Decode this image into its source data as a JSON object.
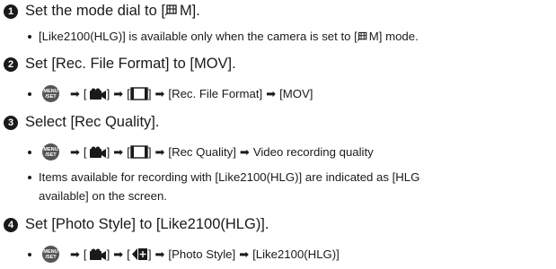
{
  "steps": [
    {
      "number": "1",
      "prefix": "Set the mode dial to [",
      "suffix": "M].",
      "notes": [
        {
          "prefix": "[Like2100(HLG)] is available only when the camera is set to [",
          "suffix": "M] mode."
        }
      ]
    },
    {
      "number": "2",
      "text": "Set [Rec. File Format] to [MOV].",
      "path": {
        "menu_icon": "menu-set-icon",
        "menu_label": [
          "MENU",
          "/SET"
        ],
        "items": [
          "[Rec. File Format]",
          "[MOV]"
        ]
      }
    },
    {
      "number": "3",
      "text": "Select [Rec Quality].",
      "path": {
        "menu_icon": "menu-set-icon",
        "menu_label": [
          "MENU",
          "/SET"
        ],
        "items": [
          "[Rec Quality]",
          "Video recording quality"
        ]
      },
      "notes": [
        {
          "line1": "Items available for recording with [Like2100(HLG)] are indicated as [HLG",
          "line2": "available] on the screen."
        }
      ]
    },
    {
      "number": "4",
      "text": "Set [Photo Style] to [Like2100(HLG)].",
      "path": {
        "menu_icon": "menu-set-icon",
        "menu_label": [
          "MENU",
          "/SET"
        ],
        "items": [
          "[Photo Style]",
          "[Like2100(HLG)]"
        ]
      }
    }
  ],
  "symbols": {
    "arrow": "➡",
    "open_bracket": "[",
    "close_bracket": "]"
  },
  "icons": [
    "video-mode-icon",
    "video-camera-tab-icon",
    "image-format-tab-icon",
    "image-quality-tab-icon"
  ]
}
